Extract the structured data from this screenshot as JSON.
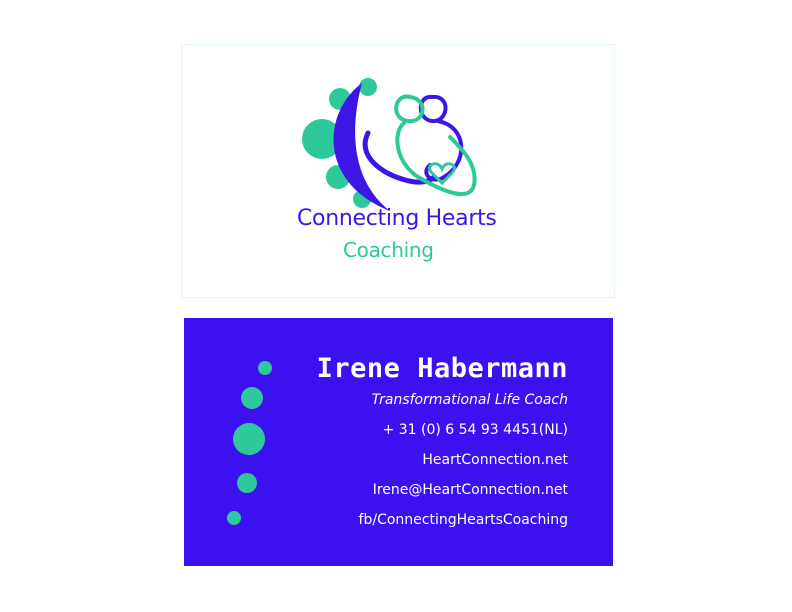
{
  "colors": {
    "brand_purple": "#3d16e6",
    "brand_green": "#2ec99a",
    "back_background": "#3d10f0",
    "back_text": "#ffffff"
  },
  "front": {
    "logo_icon": "connecting-hearts-logo-icon",
    "brand_name_line1": "Connecting Hearts",
    "brand_name_line2": "Coaching"
  },
  "back": {
    "name": "Irene Habermann",
    "title": "Transformational Life Coach",
    "phone": "+ 31 (0) 6 54 93 4451(NL)",
    "website": "HeartConnection.net",
    "email": "Irene@HeartConnection.net",
    "facebook": "fb/ConnectingHeartsCoaching"
  }
}
